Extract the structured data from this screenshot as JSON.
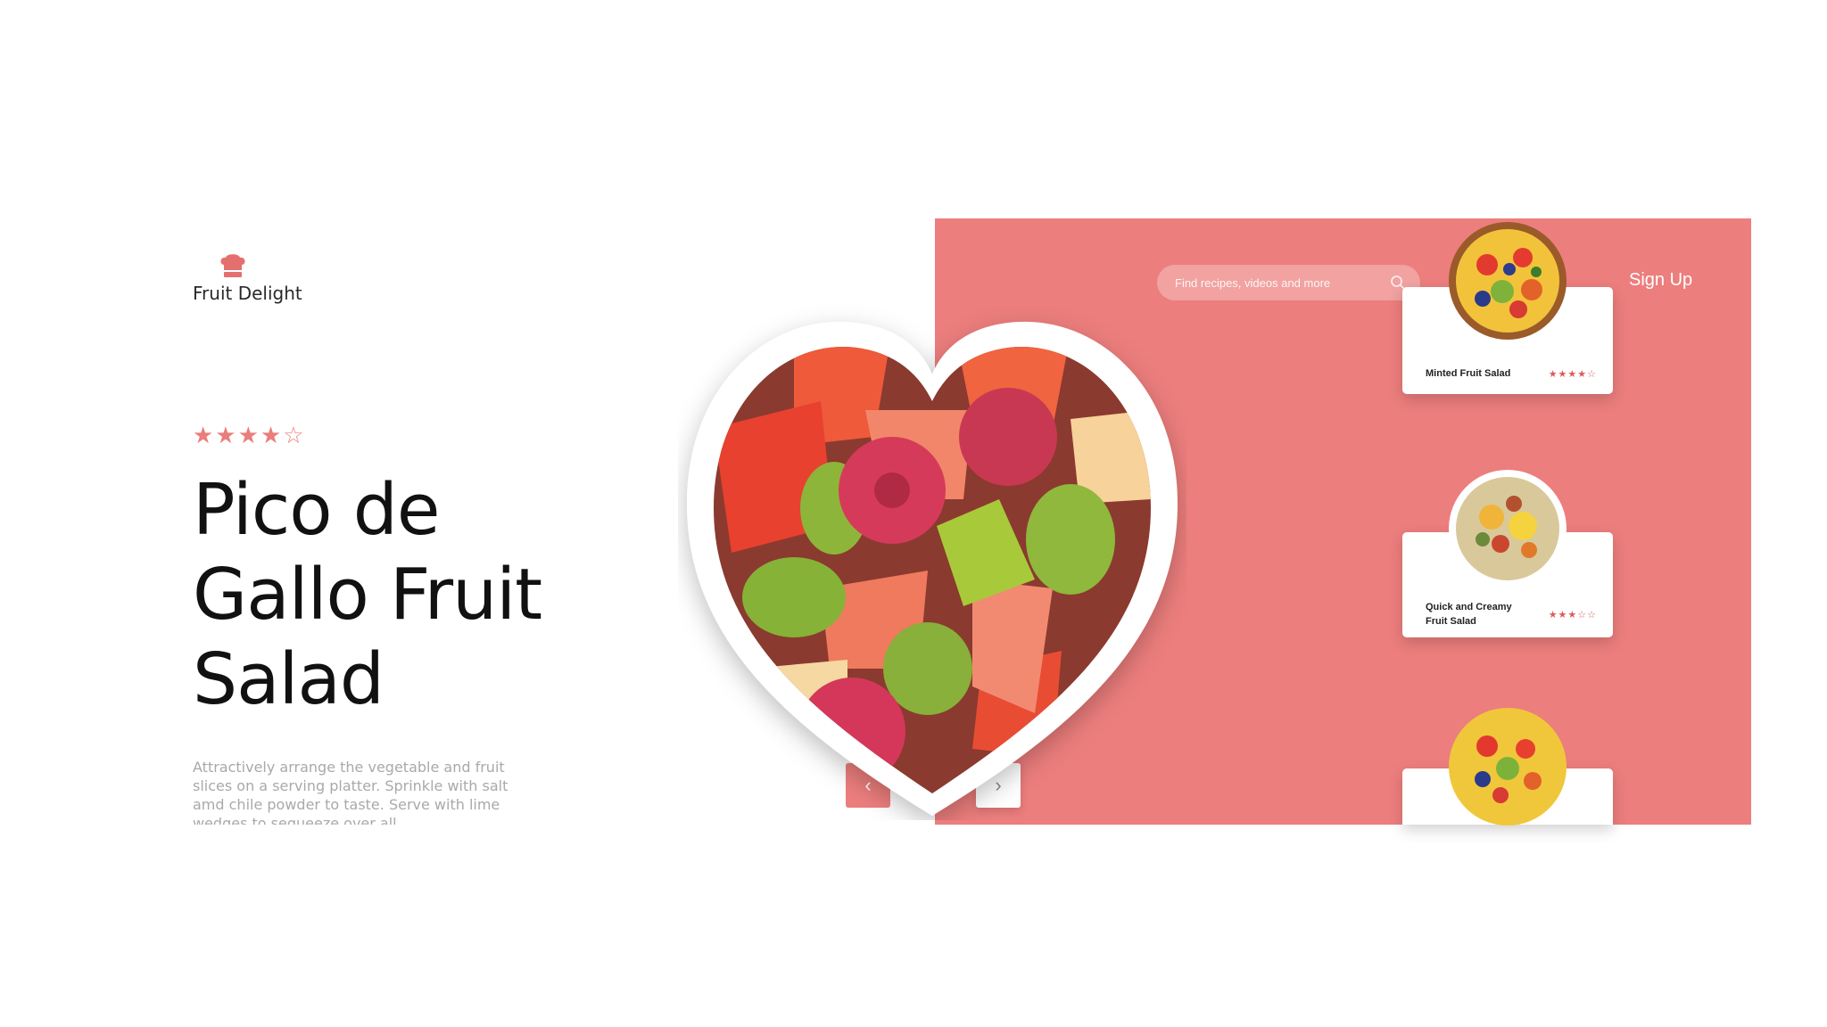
{
  "brand": {
    "name": "Fruit Delight",
    "icon": "chef-hat-icon"
  },
  "hero": {
    "rating_stars": "★★★★☆",
    "title": "Pico de Gallo Fruit Salad",
    "description": "Attractively arrange the vegetable and fruit slices on a serving platter. Sprinkle with salt amd chile powder to taste. Serve with lime wedges to sequeeze over all."
  },
  "search": {
    "placeholder": "Find recipes, videos and more",
    "icon": "search-icon"
  },
  "nav": {
    "signup_label": "Sign Up",
    "prev_label": "‹",
    "next_label": "›"
  },
  "cards": [
    {
      "name": "Minted Fruit Salad",
      "stars": "★★★★☆"
    },
    {
      "name": "Quick and Creamy Fruit Salad",
      "stars": "★★★☆☆"
    },
    {
      "name": "",
      "stars": ""
    }
  ],
  "colors": {
    "accent": "#ec7e7d",
    "star": "#ea7e7c"
  }
}
